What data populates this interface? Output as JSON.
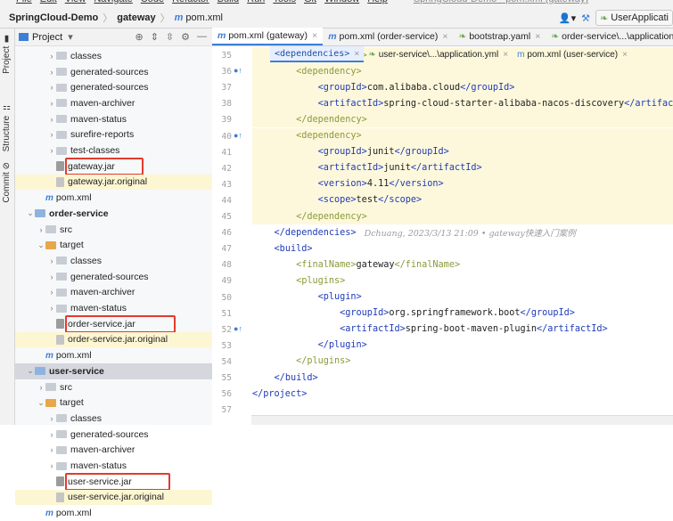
{
  "menubar": {
    "items": [
      "File",
      "Edit",
      "View",
      "Navigate",
      "Code",
      "Refactor",
      "Build",
      "Run",
      "Tools",
      "Git",
      "Window",
      "Help"
    ],
    "window_title": "SpringCloud-Demo - pom.xml (gateway)"
  },
  "navbar": {
    "project": "SpringCloud-Demo",
    "module": "gateway",
    "file": "pom.xml",
    "run_config": "UserApplicati"
  },
  "sidestrip": {
    "project": "Project",
    "structure": "Structure",
    "commit": "Commit"
  },
  "project_panel": {
    "title": "Project"
  },
  "tree": [
    {
      "label": "classes",
      "type": "folder",
      "indent": 3,
      "arrow": ">"
    },
    {
      "label": "generated-sources",
      "type": "folder",
      "indent": 3,
      "arrow": ">"
    },
    {
      "label": "generated-sources",
      "type": "folder",
      "indent": 3,
      "arrow": ">"
    },
    {
      "label": "maven-archiver",
      "type": "folder",
      "indent": 3,
      "arrow": ">"
    },
    {
      "label": "maven-status",
      "type": "folder",
      "indent": 3,
      "arrow": ">"
    },
    {
      "label": "surefire-reports",
      "type": "folder",
      "indent": 3,
      "arrow": ">"
    },
    {
      "label": "test-classes",
      "type": "folder",
      "indent": 3,
      "arrow": ">"
    },
    {
      "label": "gateway.jar",
      "type": "jar",
      "indent": 3,
      "arrow": ""
    },
    {
      "label": "gateway.jar.original",
      "type": "jaro",
      "indent": 3,
      "arrow": ""
    },
    {
      "label": "pom.xml",
      "type": "pom",
      "indent": 2,
      "arrow": ""
    },
    {
      "label": "order-service",
      "type": "module",
      "indent": 1,
      "arrow": "v"
    },
    {
      "label": "src",
      "type": "folder",
      "indent": 2,
      "arrow": ">"
    },
    {
      "label": "target",
      "type": "folderor",
      "indent": 2,
      "arrow": "v"
    },
    {
      "label": "classes",
      "type": "folder",
      "indent": 3,
      "arrow": ">"
    },
    {
      "label": "generated-sources",
      "type": "folder",
      "indent": 3,
      "arrow": ">"
    },
    {
      "label": "maven-archiver",
      "type": "folder",
      "indent": 3,
      "arrow": ">"
    },
    {
      "label": "maven-status",
      "type": "folder",
      "indent": 3,
      "arrow": ">"
    },
    {
      "label": "order-service.jar",
      "type": "jar",
      "indent": 3,
      "arrow": ""
    },
    {
      "label": "order-service.jar.original",
      "type": "jaro",
      "indent": 3,
      "arrow": ""
    },
    {
      "label": "pom.xml",
      "type": "pom",
      "indent": 2,
      "arrow": ""
    },
    {
      "label": "user-service",
      "type": "module",
      "indent": 1,
      "arrow": "v"
    },
    {
      "label": "src",
      "type": "folder",
      "indent": 2,
      "arrow": ">"
    },
    {
      "label": "target",
      "type": "folderor",
      "indent": 2,
      "arrow": "v"
    },
    {
      "label": "classes",
      "type": "folder",
      "indent": 3,
      "arrow": ">"
    },
    {
      "label": "generated-sources",
      "type": "folder",
      "indent": 3,
      "arrow": ">"
    },
    {
      "label": "maven-archiver",
      "type": "folder",
      "indent": 3,
      "arrow": ">"
    },
    {
      "label": "maven-status",
      "type": "folder",
      "indent": 3,
      "arrow": ">"
    },
    {
      "label": "user-service.jar",
      "type": "jar",
      "indent": 3,
      "arrow": ""
    },
    {
      "label": "user-service.jar.original",
      "type": "jaro",
      "indent": 3,
      "arrow": ""
    },
    {
      "label": "pom.xml",
      "type": "pom",
      "indent": 2,
      "arrow": ""
    }
  ],
  "editor_tabs": [
    {
      "label": "pom.xml (gateway)",
      "icon": "m",
      "active": true
    },
    {
      "label": "pom.xml (order-service)",
      "icon": "m",
      "active": false
    },
    {
      "label": "bootstrap.yaml",
      "icon": "y",
      "active": false
    },
    {
      "label": "order-service\\...\\application.yml",
      "icon": "y",
      "active": false
    }
  ],
  "editor_tabs2": [
    {
      "label": "<dependencies>",
      "icon": ""
    },
    {
      "label": "user-service\\...\\application.yml",
      "icon": "y"
    },
    {
      "label": "pom.xml (user-service)",
      "icon": "m"
    }
  ],
  "code_lines": [
    {
      "n": "35",
      "hl": true,
      "m": "",
      "segs": [
        {
          "t": "        "
        },
        {
          "c": "tgd",
          "t": "</dependency>"
        }
      ]
    },
    {
      "n": "36",
      "hl": true,
      "m": "●↑",
      "segs": [
        {
          "t": "        "
        },
        {
          "c": "tgd",
          "t": "<dependency>"
        }
      ]
    },
    {
      "n": "37",
      "hl": true,
      "m": "",
      "segs": [
        {
          "t": "            "
        },
        {
          "c": "tg",
          "t": "<groupId>"
        },
        {
          "c": "txt",
          "t": "com.alibaba.cloud"
        },
        {
          "c": "tg",
          "t": "</groupId>"
        }
      ]
    },
    {
      "n": "38",
      "hl": true,
      "m": "",
      "segs": [
        {
          "t": "            "
        },
        {
          "c": "tg",
          "t": "<artifactId>"
        },
        {
          "c": "txt",
          "t": "spring-cloud-starter-alibaba-nacos-discovery"
        },
        {
          "c": "tg",
          "t": "</artifactId>"
        }
      ]
    },
    {
      "n": "39",
      "hl": true,
      "m": "",
      "segs": [
        {
          "t": "        "
        },
        {
          "c": "tgd",
          "t": "</dependency>"
        }
      ]
    },
    {
      "n": "40",
      "hl": true,
      "m": "●↑",
      "segs": [
        {
          "t": "        "
        },
        {
          "c": "tgd",
          "t": "<dependency>"
        }
      ]
    },
    {
      "n": "41",
      "hl": true,
      "m": "",
      "segs": [
        {
          "t": "            "
        },
        {
          "c": "tg",
          "t": "<groupId>"
        },
        {
          "c": "txt",
          "t": "junit"
        },
        {
          "c": "tg",
          "t": "</groupId>"
        }
      ]
    },
    {
      "n": "42",
      "hl": true,
      "m": "",
      "segs": [
        {
          "t": "            "
        },
        {
          "c": "tg",
          "t": "<artifactId>"
        },
        {
          "c": "txt",
          "t": "junit"
        },
        {
          "c": "tg",
          "t": "</artifactId>"
        }
      ]
    },
    {
      "n": "43",
      "hl": true,
      "m": "",
      "segs": [
        {
          "t": "            "
        },
        {
          "c": "tg",
          "t": "<version>"
        },
        {
          "c": "txt",
          "t": "4.11"
        },
        {
          "c": "tg",
          "t": "</version>"
        }
      ]
    },
    {
      "n": "44",
      "hl": true,
      "m": "",
      "segs": [
        {
          "t": "            "
        },
        {
          "c": "tg",
          "t": "<scope>"
        },
        {
          "c": "txt",
          "t": "test"
        },
        {
          "c": "tg",
          "t": "</scope>"
        }
      ]
    },
    {
      "n": "45",
      "hl": true,
      "m": "",
      "segs": [
        {
          "t": "        "
        },
        {
          "c": "tgd",
          "t": "</dependency>"
        }
      ]
    },
    {
      "n": "46",
      "hl": false,
      "m": "",
      "segs": [
        {
          "t": "    "
        },
        {
          "c": "tg",
          "t": "</dependencies>"
        },
        {
          "c": "inlay",
          "t": "   Dchuang, 2023/3/13 21:09 • gateway快速入门案例"
        }
      ]
    },
    {
      "n": "47",
      "hl": false,
      "m": "",
      "segs": [
        {
          "t": "    "
        },
        {
          "c": "tg",
          "t": "<build>"
        }
      ]
    },
    {
      "n": "48",
      "hl": false,
      "m": "",
      "segs": [
        {
          "t": "        "
        },
        {
          "c": "tgd",
          "t": "<finalName>"
        },
        {
          "c": "txt",
          "t": "gateway"
        },
        {
          "c": "tgd",
          "t": "</finalName>"
        }
      ]
    },
    {
      "n": "49",
      "hl": false,
      "m": "",
      "segs": [
        {
          "t": "        "
        },
        {
          "c": "tgd",
          "t": "<plugins>"
        }
      ]
    },
    {
      "n": "50",
      "hl": false,
      "m": "",
      "segs": [
        {
          "t": "            "
        },
        {
          "c": "tg",
          "t": "<plugin>"
        }
      ]
    },
    {
      "n": "51",
      "hl": false,
      "m": "",
      "segs": [
        {
          "t": "                "
        },
        {
          "c": "tg",
          "t": "<groupId>"
        },
        {
          "c": "txt",
          "t": "org.springframework.boot"
        },
        {
          "c": "tg",
          "t": "</groupId>"
        }
      ]
    },
    {
      "n": "52",
      "hl": false,
      "m": "●↑",
      "segs": [
        {
          "t": "                "
        },
        {
          "c": "tg",
          "t": "<artifactId>"
        },
        {
          "c": "txt",
          "t": "spring-boot-maven-plugin"
        },
        {
          "c": "tg",
          "t": "</artifactId>"
        }
      ]
    },
    {
      "n": "53",
      "hl": false,
      "m": "",
      "segs": [
        {
          "t": "            "
        },
        {
          "c": "tg",
          "t": "</plugin>"
        }
      ]
    },
    {
      "n": "54",
      "hl": false,
      "m": "",
      "segs": [
        {
          "t": "        "
        },
        {
          "c": "tgd",
          "t": "</plugins>"
        }
      ]
    },
    {
      "n": "55",
      "hl": false,
      "m": "",
      "segs": [
        {
          "t": "    "
        },
        {
          "c": "tg",
          "t": "</build>"
        }
      ]
    },
    {
      "n": "56",
      "hl": false,
      "m": "",
      "segs": [
        {
          "c": "tg",
          "t": "</project>"
        }
      ]
    },
    {
      "n": "57",
      "hl": false,
      "m": "",
      "segs": []
    }
  ],
  "colors": {
    "red_box": "#e23b2e",
    "highlight": "#fdf8dc",
    "tag": "#1f3bb8"
  },
  "highlighted_jars": [
    "gateway.jar",
    "order-service.jar",
    "user-service.jar"
  ]
}
